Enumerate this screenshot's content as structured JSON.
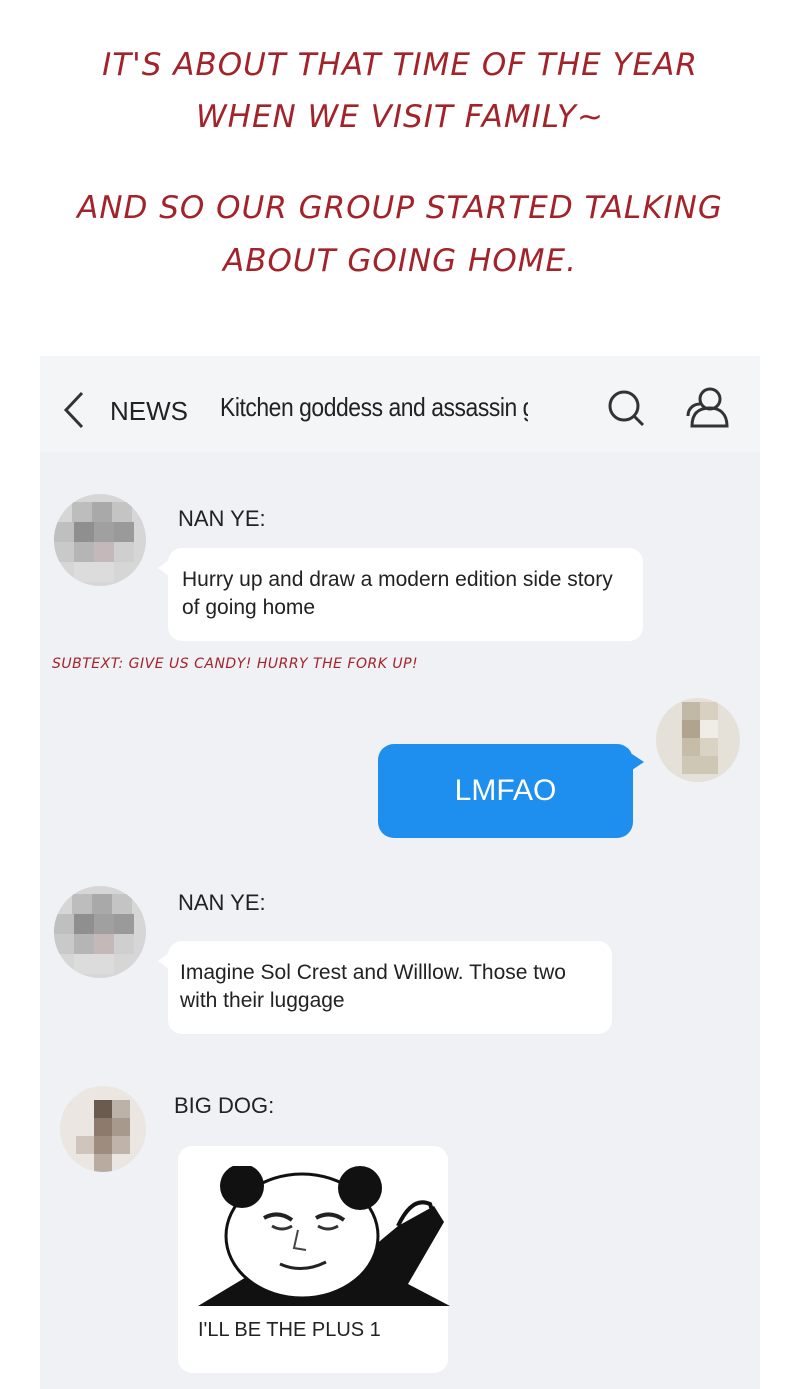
{
  "caption": {
    "line1": "IT'S ABOUT THAT TIME OF THE YEAR",
    "line2": "WHEN WE VISIT FAMILY~",
    "line3": "AND SO OUR GROUP STARTED  TALKING",
    "line4": "ABOUT GOING HOME."
  },
  "topbar": {
    "back_label": "NEWS",
    "chat_title": "Kitchen goddess and assassin grou...",
    "icons": [
      "chevron-left-icon",
      "search-icon",
      "group-icon"
    ]
  },
  "messages": [
    {
      "sender": "NAN YE:",
      "text": "Hurry up and draw a modern edition side story of going home"
    },
    {
      "sender": "me",
      "text": "LMFAO"
    },
    {
      "sender": "NAN YE:",
      "text": "Imagine Sol Crest and Willlow. Those two with their luggage"
    },
    {
      "sender": "BIG DOG:",
      "text": "I'LL BE THE PLUS 1",
      "sticker": "panda-meme-sticker"
    }
  ],
  "subtext": "SUBTEXT: GIVE US CANDY! HURRY THE FORK UP!",
  "colors": {
    "caption_red": "#a3232a",
    "chat_background": "#eff1f5",
    "my_bubble": "#1e8eef",
    "bubble": "#ffffff"
  }
}
